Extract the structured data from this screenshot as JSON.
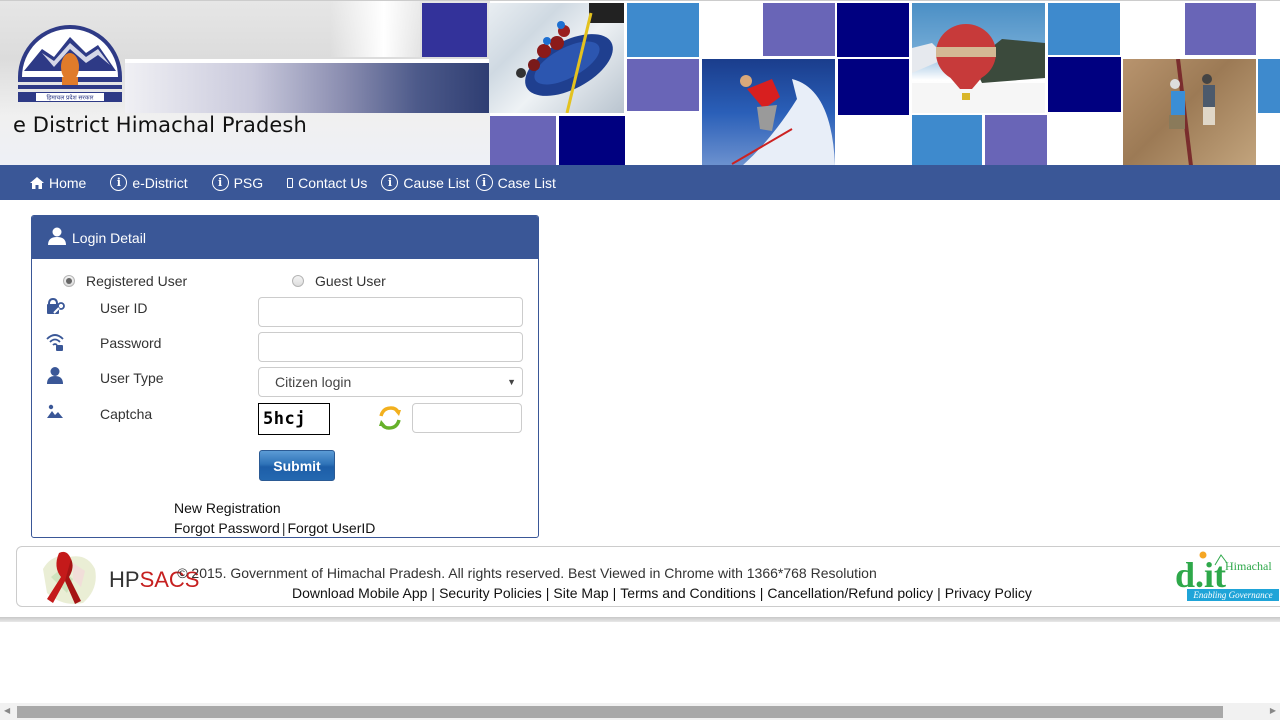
{
  "header": {
    "site_title": "e District Himachal Pradesh",
    "emblem_caption": "हिमाचल प्रदेश सरकार",
    "tile_colors": {
      "indigo": "#33329a",
      "navy": "#000080",
      "sky": "#3e8acd",
      "violet": "#6965b7"
    },
    "photos": [
      "river rafting",
      "skiing",
      "hot air balloon",
      "rock climbing"
    ]
  },
  "nav": {
    "background": "#3a5797",
    "items": [
      {
        "label": "Home",
        "icon": "home-icon"
      },
      {
        "label": "e-District",
        "icon": "info-icon"
      },
      {
        "label": "PSG",
        "icon": "info-icon"
      },
      {
        "label": "Contact Us",
        "icon": "phone-icon"
      },
      {
        "label": "Cause List",
        "icon": "info-icon"
      },
      {
        "label": "Case List",
        "icon": "info-icon"
      }
    ]
  },
  "login": {
    "title": "Login Detail",
    "user_mode": {
      "options": [
        "Registered User",
        "Guest User"
      ],
      "selected": "Registered User"
    },
    "fields": {
      "user_id": {
        "label": "User ID",
        "value": "",
        "placeholder": ""
      },
      "password": {
        "label": "Password",
        "value": "",
        "placeholder": ""
      },
      "user_type": {
        "label": "User Type",
        "selected": "Citizen login"
      },
      "captcha": {
        "label": "Captcha",
        "image_text": "5hcj",
        "value": ""
      }
    },
    "submit_label": "Submit",
    "links": {
      "new_registration": "New Registration",
      "forgot_password": "Forgot Password",
      "separator": "|",
      "forgot_userid": "Forgot UserID"
    }
  },
  "footer": {
    "left_logo": {
      "hp": "HP",
      "sacs": "SACS"
    },
    "copyright": "© 2015. Government of Himachal Pradesh. All rights reserved. Best Viewed in Chrome with 1366*768 Resolution",
    "links": [
      "Download Mobile App",
      "Security Policies",
      "Site Map",
      "Terms and Conditions",
      "Cancellation/Refund policy",
      "Privacy Policy"
    ],
    "link_separator": "|",
    "right_logo": {
      "main": "d.it",
      "region": "Himachal",
      "tagline": "Enabling Governance"
    }
  }
}
